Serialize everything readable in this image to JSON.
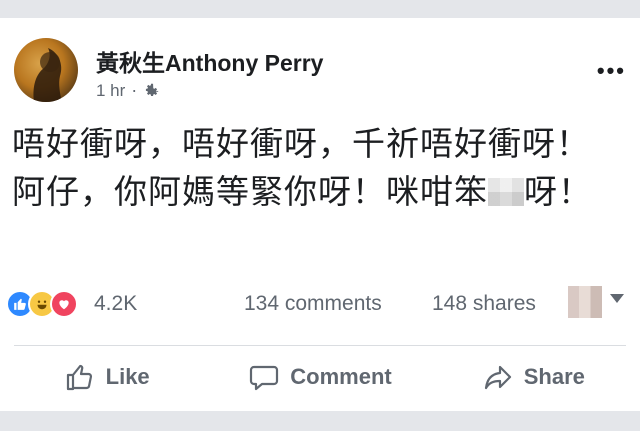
{
  "post": {
    "author": "黃秋生Anthony Perry",
    "time": "1 hr",
    "separator": "·",
    "more_label": "•••",
    "text_part1": "唔好衝呀，唔好衝呀，千祈唔好衝呀！阿仔，你阿媽等緊你呀！咪咁笨",
    "text_part2": "呀！"
  },
  "stats": {
    "reaction_count": "4.2K",
    "comments": "134 comments",
    "shares": "148 shares",
    "reactions": [
      "like",
      "haha",
      "love"
    ]
  },
  "actions": {
    "like_label": "Like",
    "comment_label": "Comment",
    "share_label": "Share"
  },
  "icons": {
    "privacy": "gear-icon",
    "like": "thumbs-up-icon",
    "comment": "speech-bubble-icon",
    "share": "share-arrow-icon"
  },
  "colors": {
    "like_reaction": "#2e89ff",
    "haha_reaction": "#f7c844",
    "love_reaction": "#f0445f",
    "secondary_text": "#606770"
  }
}
